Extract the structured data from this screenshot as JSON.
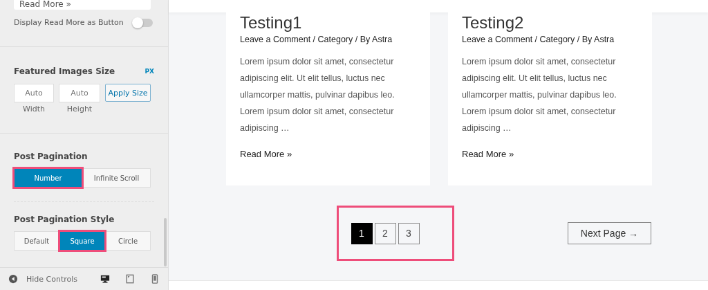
{
  "sidebar": {
    "read_more_field": {
      "value": "Read More »"
    },
    "toggle": {
      "label": "Display Read More as Button",
      "on": false
    },
    "image_size": {
      "title": "Featured Images Size",
      "unit": "PX",
      "width": {
        "value": "Auto",
        "caption": "Width"
      },
      "height": {
        "value": "Auto",
        "caption": "Height"
      },
      "apply": "Apply Size"
    },
    "pagination": {
      "title": "Post Pagination",
      "options": [
        {
          "label": "Number",
          "selected": true,
          "highlighted": true
        },
        {
          "label": "Infinite Scroll",
          "selected": false,
          "highlighted": false
        }
      ]
    },
    "pagination_style": {
      "title": "Post Pagination Style",
      "options": [
        {
          "label": "Default",
          "selected": false,
          "highlighted": false
        },
        {
          "label": "Square",
          "selected": true,
          "highlighted": true
        },
        {
          "label": "Circle",
          "selected": false,
          "highlighted": false
        }
      ]
    },
    "footer": {
      "hide_controls": "Hide Controls",
      "devices": [
        {
          "kind": "desktop",
          "selected": true
        },
        {
          "kind": "tablet",
          "selected": false
        },
        {
          "kind": "mobile",
          "selected": false
        }
      ]
    }
  },
  "posts": [
    {
      "title": "Testing1",
      "meta": "Leave a Comment / Category / By Astra",
      "excerpt": "Lorem ipsum dolor sit amet, consectetur adipiscing elit. Ut elit tellus, luctus nec ullamcorper mattis, pulvinar dapibus leo. Lorem ipsum dolor sit amet, consectetur adipiscing …",
      "read_more": "Read More »"
    },
    {
      "title": "Testing2",
      "meta": "Leave a Comment / Category / By Astra",
      "excerpt": "Lorem ipsum dolor sit amet, consectetur adipiscing elit. Ut elit tellus, luctus nec ullamcorper mattis, pulvinar dapibus leo. Lorem ipsum dolor sit amet, consectetur adipiscing …",
      "read_more": "Read More »"
    }
  ],
  "pagination": {
    "highlighted": true,
    "pages": [
      {
        "label": "1",
        "selected": true
      },
      {
        "label": "2",
        "selected": false
      },
      {
        "label": "3",
        "selected": false
      }
    ],
    "next": "Next Page →"
  }
}
